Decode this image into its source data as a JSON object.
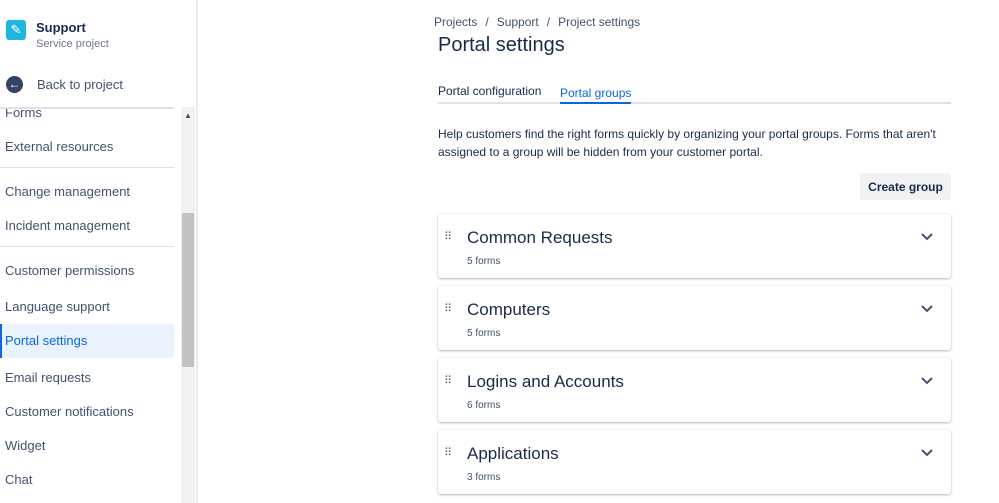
{
  "project": {
    "name": "Support",
    "type": "Service project"
  },
  "back_label": "Back to project",
  "nav": [
    {
      "label": "Forms"
    },
    {
      "label": "External resources"
    },
    {
      "label": "Change management"
    },
    {
      "label": "Incident management"
    },
    {
      "label": "Customer permissions"
    },
    {
      "label": "Language support"
    },
    {
      "label": "Portal settings",
      "active": true
    },
    {
      "label": "Email requests"
    },
    {
      "label": "Customer notifications"
    },
    {
      "label": "Widget"
    },
    {
      "label": "Chat"
    }
  ],
  "breadcrumbs": [
    "Projects",
    "Support",
    "Project settings"
  ],
  "title": "Portal settings",
  "tabs": [
    {
      "label": "Portal configuration"
    },
    {
      "label": "Portal groups",
      "active": true
    }
  ],
  "description": "Help customers find the right forms quickly by organizing your portal groups. Forms that aren't assigned to a group will be hidden from your customer portal.",
  "create_label": "Create group",
  "groups": [
    {
      "name": "Common Requests",
      "count": "5 forms"
    },
    {
      "name": "Computers",
      "count": "5 forms"
    },
    {
      "name": "Logins and Accounts",
      "count": "6 forms"
    },
    {
      "name": "Applications",
      "count": "3 forms"
    }
  ],
  "colors": {
    "accent": "#0c66e4",
    "active_bg": "#e9f2ff"
  }
}
